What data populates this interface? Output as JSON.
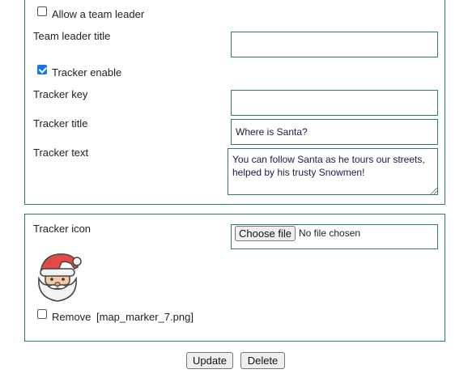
{
  "team_leader": {
    "allow_label": "Allow a team leader",
    "allow_checked": false,
    "title_label": "Team leader title",
    "title_value": ""
  },
  "tracker": {
    "enable_label": "Tracker enable",
    "enable_checked": true,
    "key_label": "Tracker key",
    "key_value": "",
    "title_label": "Tracker title",
    "title_value": "Where is Santa?",
    "text_label": "Tracker text",
    "text_value": "You can follow Santa as he tours our streets, helped by his trusty Snowmen!",
    "icon_label": "Tracker icon",
    "choose_file_label": "Choose file",
    "no_file_label": "No file chosen",
    "icon_name": "santa-icon",
    "remove_label": "Remove",
    "current_file": "[map_marker_7.png]"
  },
  "actions": {
    "update_label": "Update",
    "delete_label": "Delete"
  },
  "colors": {
    "border": "#2e7d6b",
    "checkbox_checked": "#1a73e8"
  }
}
